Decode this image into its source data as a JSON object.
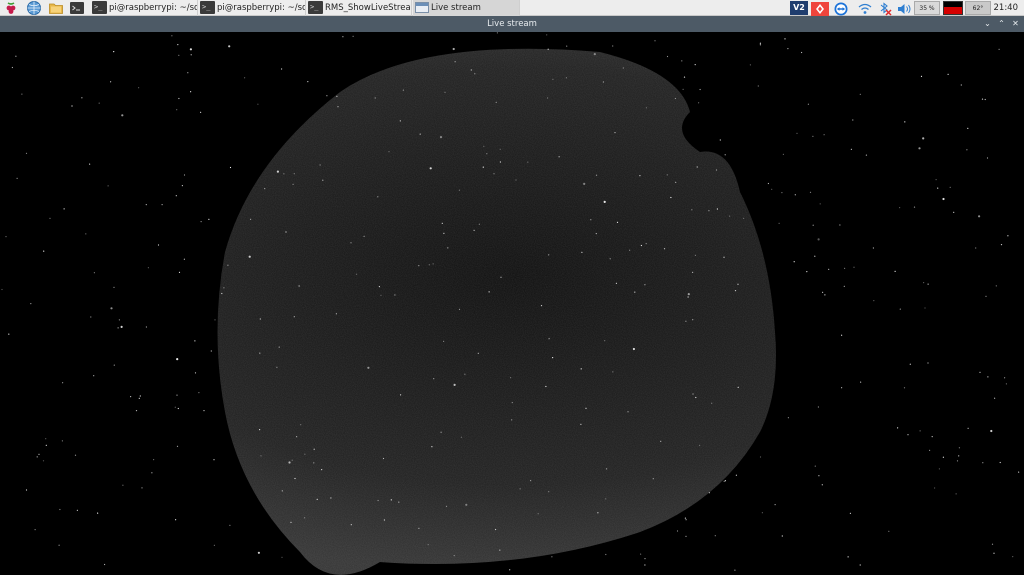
{
  "taskbar": {
    "launchers": [
      {
        "icon": "raspberry-menu-icon"
      },
      {
        "icon": "web-browser-icon"
      },
      {
        "icon": "file-manager-icon"
      },
      {
        "icon": "terminal-icon"
      }
    ],
    "tasks": [
      {
        "label": "pi@raspberrypi: ~/so...",
        "icon": "terminal-icon",
        "active": false
      },
      {
        "label": "pi@raspberrypi: ~/so...",
        "icon": "terminal-icon",
        "active": false
      },
      {
        "label": "RMS_ShowLiveStrea...",
        "icon": "terminal-icon",
        "active": false
      },
      {
        "label": "Live stream",
        "icon": "window-icon",
        "active": true
      }
    ],
    "tray": {
      "vnc_label": "V2",
      "cpu_label": "35 %",
      "temp_label": "62°",
      "clock": "21:40"
    }
  },
  "window": {
    "title": "Live stream",
    "controls": [
      "minimize",
      "maximize",
      "close"
    ]
  },
  "colors": {
    "panel": "#ededed",
    "titlebar": "#4d5a66",
    "sky": "#000000"
  }
}
